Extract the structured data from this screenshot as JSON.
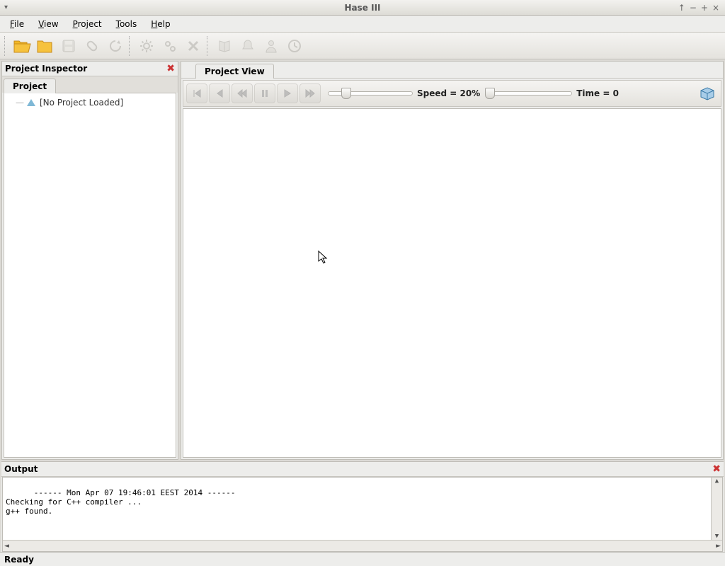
{
  "window": {
    "title": "Hase III"
  },
  "menu": {
    "file": "File",
    "view": "View",
    "project": "Project",
    "tools": "Tools",
    "help": "Help"
  },
  "inspector": {
    "title": "Project Inspector",
    "tab": "Project",
    "root": "[No Project Loaded]"
  },
  "project_view": {
    "tab": "Project View",
    "speed_label": "Speed = 20%",
    "time_label": "Time = 0",
    "speed_pct": 20,
    "time_pct": 0
  },
  "output": {
    "title": "Output",
    "lines": "------ Mon Apr 07 19:46:01 EEST 2014 ------\nChecking for C++ compiler ...\ng++ found."
  },
  "status": {
    "text": "Ready"
  }
}
